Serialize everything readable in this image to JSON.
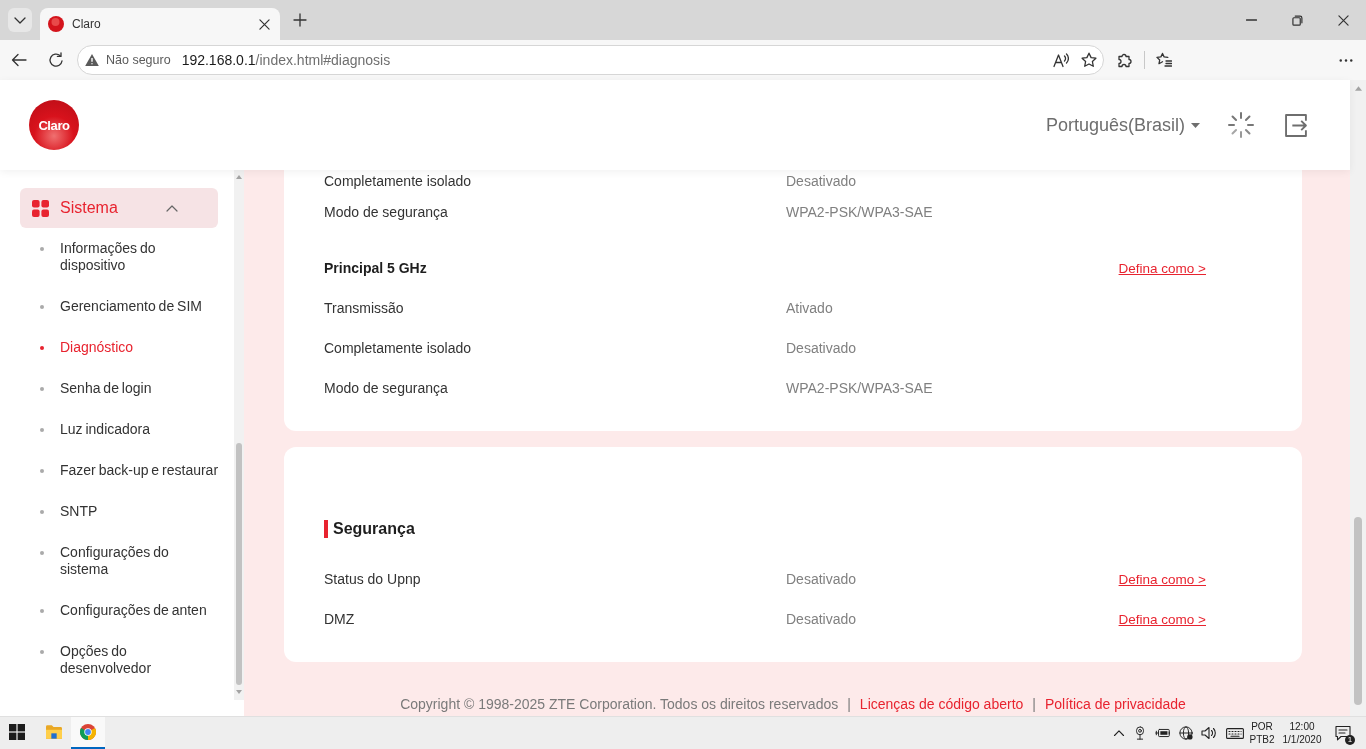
{
  "browser": {
    "tabs": [
      {
        "title": "Claro",
        "selected": true
      }
    ],
    "address_bar": {
      "security": "Não seguro",
      "url": "192.168.0.1/index.html#diagnosis"
    }
  },
  "header": {
    "logo": "Claro",
    "language": "Português(Brasil)"
  },
  "sidebar": {
    "groups": [
      {
        "label": "Sistema",
        "selected": true,
        "expanded": true,
        "items": [
          {
            "label": "Informações do dispositivo",
            "selected": false
          },
          {
            "label": "Gerenciamento de SIM",
            "selected": false
          },
          {
            "label": "Diagnóstico",
            "selected": true
          },
          {
            "label": "Senha de login",
            "selected": false
          },
          {
            "label": "Luz indicadora",
            "selected": false
          },
          {
            "label": "Fazer back-up e restaurar",
            "selected": false
          },
          {
            "label": "SNTP",
            "selected": false
          },
          {
            "label": "Configurações do sistema",
            "selected": false
          },
          {
            "label": "Configurações de anten",
            "selected": false
          },
          {
            "label": "Opções do desenvolvedor",
            "selected": false
          }
        ]
      }
    ]
  },
  "cards": [
    {
      "rows": [
        {
          "kind": "row",
          "label": "Completamente isolado",
          "value": "Desativado"
        },
        {
          "kind": "row",
          "label": "Modo de segurança",
          "value": "WPA2-PSK/WPA3-SAE"
        },
        {
          "kind": "subheading",
          "label": "Principal 5 GHz",
          "link": "Defina como >"
        },
        {
          "kind": "row",
          "label": "Transmissão",
          "value": "Ativado"
        },
        {
          "kind": "row",
          "label": "Completamente isolado",
          "value": "Desativado"
        },
        {
          "kind": "row",
          "label": "Modo de segurança",
          "value": "WPA2-PSK/WPA3-SAE"
        }
      ]
    },
    {
      "title": "Segurança",
      "rows": [
        {
          "kind": "row",
          "label": "Status do Upnp",
          "value": "Desativado",
          "link": "Defina como >"
        },
        {
          "kind": "row",
          "label": "DMZ",
          "value": "Desativado",
          "link": "Defina como >"
        }
      ]
    }
  ],
  "footer": {
    "copyright": "Copyright © 1998-2025 ZTE Corporation. Todos os direitos reservados",
    "links": [
      {
        "separator": "|",
        "label": "Licenças de código aberto"
      },
      {
        "separator": "|",
        "label": "Política de privacidade"
      }
    ]
  },
  "taskbar": {
    "apps": [
      {
        "kind": "start",
        "selected": false
      },
      {
        "kind": "files",
        "selected": false
      },
      {
        "kind": "browser",
        "selected": true
      }
    ],
    "tray": {
      "input_language": "POR",
      "keyboard_layout": "PTB2",
      "time": "12:00",
      "date": "1/1/2020",
      "notification_count": "1"
    }
  }
}
